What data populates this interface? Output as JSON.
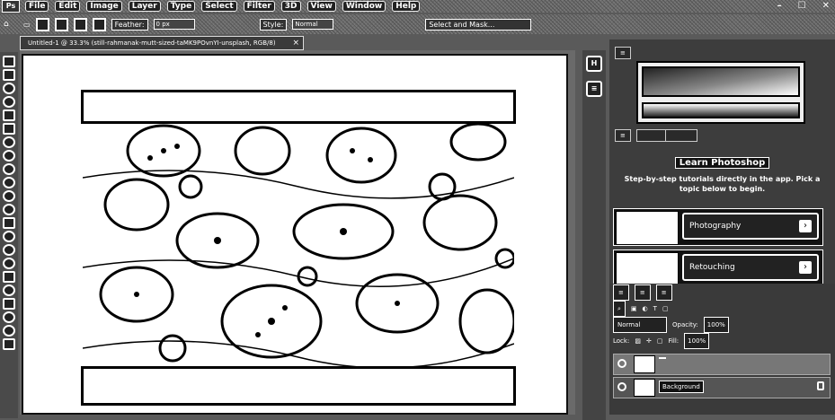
{
  "app": {
    "logo": "Ps",
    "menu": [
      "File",
      "Edit",
      "Image",
      "Layer",
      "Type",
      "Select",
      "Filter",
      "3D",
      "View",
      "Window",
      "Help"
    ],
    "window_controls": [
      "–",
      "☐",
      "✕"
    ]
  },
  "options_bar": {
    "feather_label": "Feather:",
    "feather_value": "0 px",
    "style_label": "Style:",
    "style_value": "Normal",
    "select_mask_label": "Select and Mask..."
  },
  "document": {
    "tab_title": "Untitled-1 @ 33.3% (still-rahmanak-mutt-sized-taMK9POvnYI-unsplash, RGB/8)",
    "close": "×"
  },
  "learn": {
    "title": "Learn Photoshop",
    "description": "Step-by-step tutorials directly in the app. Pick a topic below to begin.",
    "cards": [
      {
        "label": "Photography"
      },
      {
        "label": "Retouching"
      }
    ]
  },
  "layers": {
    "blend_mode": "Normal",
    "opacity_label": "Opacity:",
    "opacity_value": "100%",
    "lock_label": "Lock:",
    "fill_label": "Fill:",
    "fill_value": "100%",
    "items": [
      {
        "name": ""
      },
      {
        "name": "Background"
      }
    ]
  },
  "icons": {
    "strip": [
      "history-icon",
      "properties-icon"
    ],
    "tools": [
      "move",
      "marquee",
      "lasso",
      "quick-select",
      "crop",
      "frame",
      "eyedropper",
      "healing",
      "brush",
      "stamp",
      "history-brush",
      "eraser",
      "gradient",
      "blur",
      "dodge",
      "pen",
      "type",
      "path-select",
      "rectangle",
      "hand",
      "zoom"
    ]
  }
}
